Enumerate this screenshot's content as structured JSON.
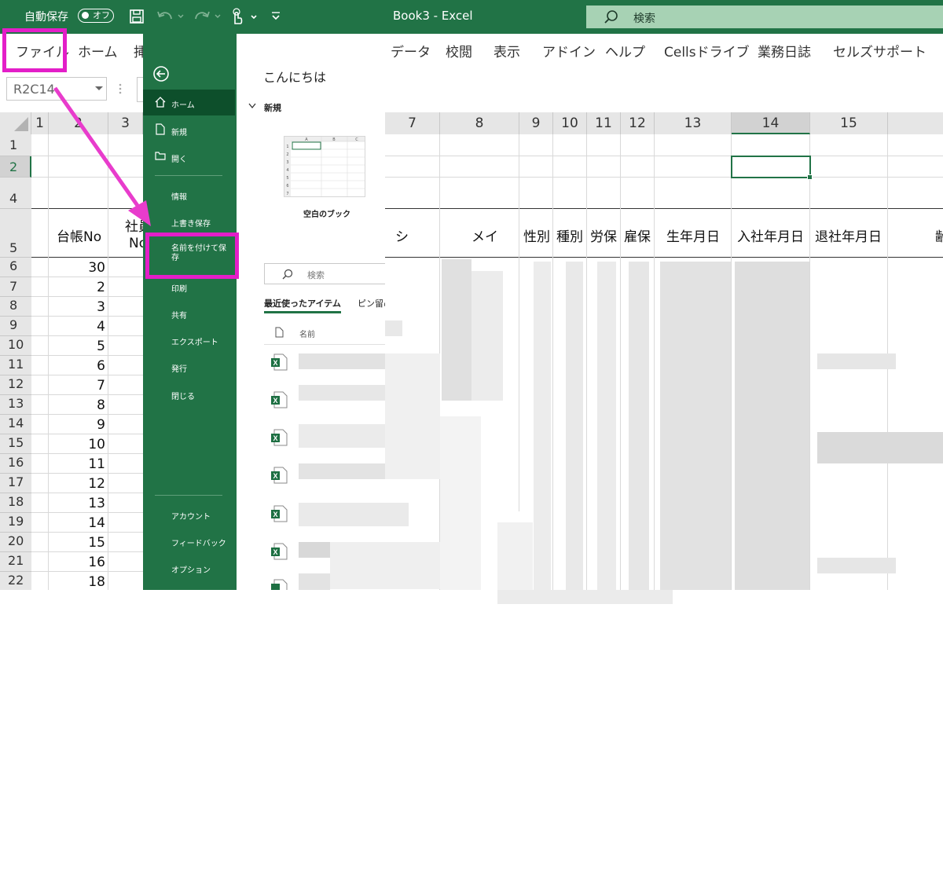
{
  "titlebar": {
    "autosave_label": "自動保存",
    "autosave_state": "オフ",
    "document_title": "Book3  -  Excel",
    "search_placeholder": "検索"
  },
  "ribbon": {
    "tabs": [
      "ファイル",
      "ホーム",
      "挿",
      "データ",
      "校閲",
      "表示",
      "アドイン",
      "ヘルプ",
      "Cellsドライブ",
      "業務日誌",
      "セルズサポート"
    ]
  },
  "formula_bar": {
    "name_box": "R2C14"
  },
  "grid": {
    "col_headers": [
      "1",
      "2",
      "3",
      "7",
      "8",
      "9",
      "10",
      "11",
      "12",
      "13",
      "14",
      "15"
    ],
    "row_headers": [
      "1",
      "2",
      "4",
      "5",
      "6",
      "7",
      "8",
      "9",
      "10",
      "11",
      "12",
      "13",
      "14",
      "15",
      "16",
      "17",
      "18",
      "19",
      "20",
      "21",
      "22"
    ],
    "header_cells": {
      "ledger_no": "台帳No",
      "employee_a": "社員",
      "employee_b": "No",
      "kana_first_partial": "シ",
      "kana_mei": "メイ",
      "gender": "性別",
      "type": "種別",
      "labor_ins": "労保",
      "emp_ins": "雇保",
      "birth": "生年月日",
      "join": "入社年月日",
      "leave": "退社年月日",
      "last_partial": "齢"
    },
    "ledger_values": [
      "30",
      "2",
      "3",
      "4",
      "5",
      "6",
      "7",
      "8",
      "9",
      "10",
      "11",
      "12",
      "13",
      "14",
      "15",
      "16",
      "18"
    ]
  },
  "backstage": {
    "nav": {
      "home": "ホーム",
      "new": "新規",
      "open": "開く",
      "info": "情報",
      "save": "上書き保存",
      "save_as": "名前を付けて保存",
      "print": "印刷",
      "share": "共有",
      "export": "エクスポート",
      "publish": "発行",
      "close": "閉じる",
      "account": "アカウント",
      "feedback": "フィードバック",
      "options": "オプション"
    },
    "greeting": "こんにちは",
    "new_section": "新規",
    "blank_workbook": "空白のブック",
    "thumb_cols": [
      "A",
      "B",
      "C"
    ],
    "thumb_rows": [
      "1",
      "2",
      "3",
      "4",
      "5",
      "6",
      "7"
    ],
    "search_placeholder": "検索",
    "recent_tab": "最近使ったアイテム",
    "pinned_tab": "ピン留め",
    "name_col": "名前"
  },
  "colors": {
    "excel_green": "#217346",
    "highlight_magenta": "#e31ec8",
    "arrow_magenta": "#e83ccc"
  },
  "icons": [
    "save-icon",
    "undo-icon",
    "redo-icon",
    "touch-mode-icon",
    "customize-qat-icon",
    "search-icon",
    "back-arrow-icon",
    "home-icon",
    "new-file-icon",
    "open-folder-icon",
    "file-icon",
    "excel-file-icon"
  ]
}
